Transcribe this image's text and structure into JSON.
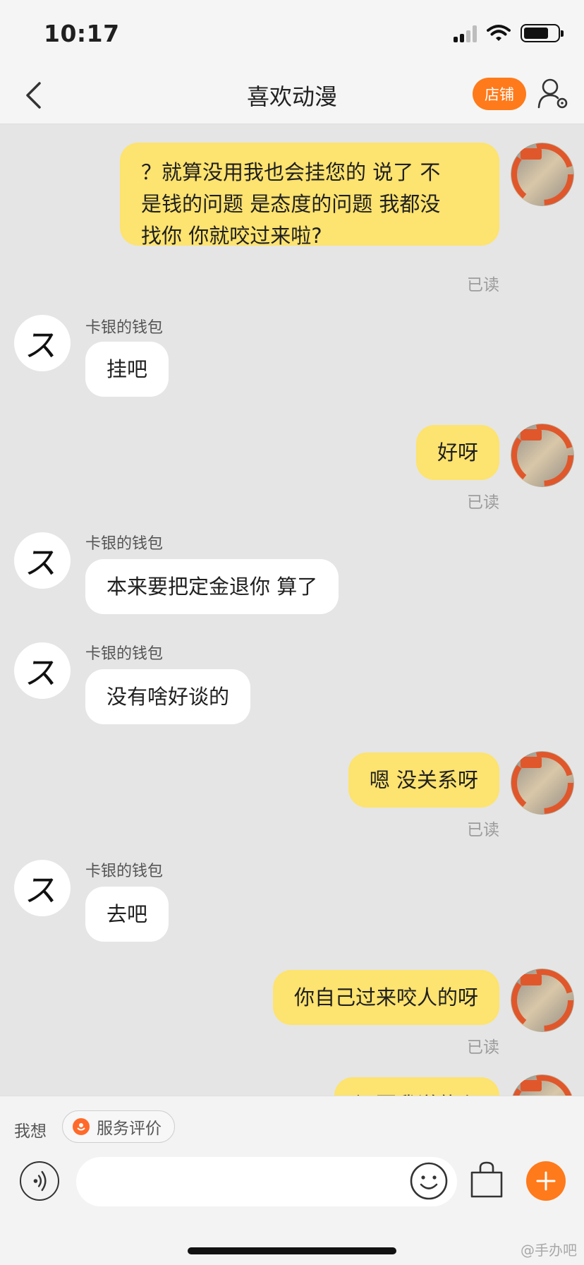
{
  "status": {
    "time": "10:17"
  },
  "header": {
    "title": "喜欢动漫",
    "store_label": "店铺"
  },
  "chat": {
    "sender_name": "卡银的钱包",
    "them_avatar_glyph": "ス",
    "read_label": "已读",
    "messages": [
      {
        "from": "me",
        "lines": [
          "？就算没用我也会挂您的 说了 不",
          "是钱的问题 是态度的问题 我都没",
          "找你 你就咬过来啦?"
        ]
      },
      {
        "from": "them",
        "text": "挂吧"
      },
      {
        "from": "me",
        "text": "好呀"
      },
      {
        "from": "them",
        "text": "本来要把定金退你 算了"
      },
      {
        "from": "them",
        "text": "没有啥好谈的"
      },
      {
        "from": "me",
        "text": "嗯 没关系呀"
      },
      {
        "from": "them",
        "text": "去吧"
      },
      {
        "from": "me",
        "text": "你自己过来咬人的呀"
      },
      {
        "from": "me",
        "text": "还要我说什么"
      }
    ]
  },
  "bottom": {
    "want_label": "我想",
    "chip_label": "服务评价",
    "input_value": "",
    "input_placeholder": ""
  },
  "watermark": "@手办吧"
}
